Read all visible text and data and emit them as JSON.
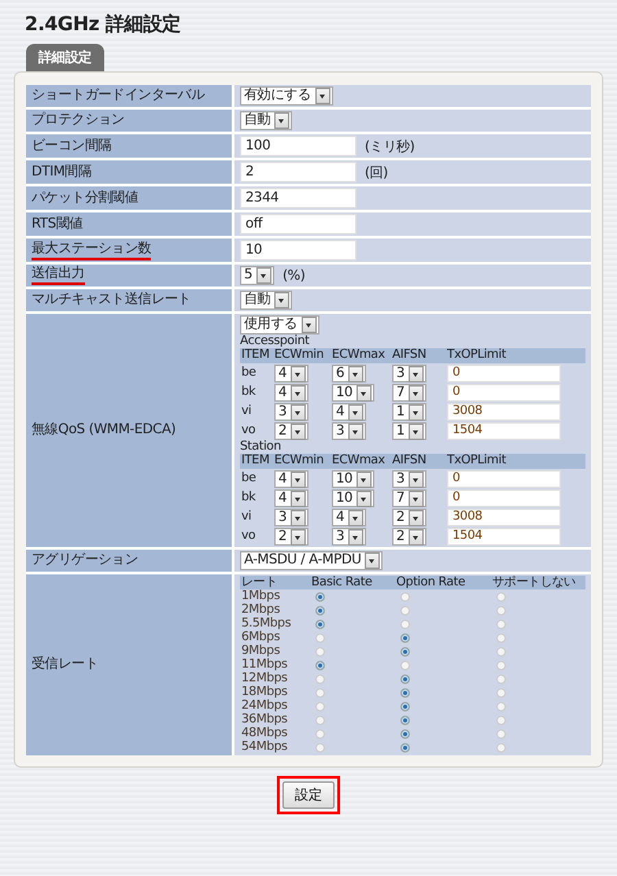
{
  "page_title": "2.4GHz 詳細設定",
  "tab": {
    "label": "詳細設定",
    "selected": true
  },
  "settings": [
    {
      "kind": "select",
      "label": "ショートガードインターバル",
      "value": "有効にする",
      "underlined": false
    },
    {
      "kind": "select",
      "label": "プロテクション",
      "value": "自動",
      "underlined": false
    },
    {
      "kind": "input",
      "label": "ビーコン間隔",
      "value": "100",
      "unit": "(ミリ秒)",
      "underlined": false
    },
    {
      "kind": "input",
      "label": "DTIM間隔",
      "value": "2",
      "unit": "(回)",
      "underlined": false
    },
    {
      "kind": "input",
      "label": "パケット分割閾値",
      "value": "2344",
      "underlined": false
    },
    {
      "kind": "input",
      "label": "RTS閾値",
      "value": "off",
      "underlined": false
    },
    {
      "kind": "input",
      "label": "最大ステーション数",
      "value": "10",
      "underlined": true
    },
    {
      "kind": "select",
      "label": "送信出力",
      "value": "5",
      "unit": "(%)",
      "underlined": true
    },
    {
      "kind": "select",
      "label": "マルチキャスト送信レート",
      "value": "自動",
      "underlined": false
    },
    {
      "kind": "qos",
      "label": "無線QoS (WMM-EDCA)",
      "value": "使用する",
      "underlined": false,
      "groups": [
        {
          "title": "Accesspoint",
          "columns": [
            "ITEM",
            "ECWmin",
            "ECWmax",
            "AIFSN",
            "TxOPLimit"
          ],
          "rows": [
            {
              "item": "be",
              "ecwmin": "4",
              "ecwmax": "6",
              "aifsn": "3",
              "txop": "0"
            },
            {
              "item": "bk",
              "ecwmin": "4",
              "ecwmax": "10",
              "aifsn": "7",
              "txop": "0"
            },
            {
              "item": "vi",
              "ecwmin": "3",
              "ecwmax": "4",
              "aifsn": "1",
              "txop": "3008"
            },
            {
              "item": "vo",
              "ecwmin": "2",
              "ecwmax": "3",
              "aifsn": "1",
              "txop": "1504"
            }
          ]
        },
        {
          "title": "Station",
          "columns": [
            "ITEM",
            "ECWmin",
            "ECWmax",
            "AIFSN",
            "TxOPLimit"
          ],
          "rows": [
            {
              "item": "be",
              "ecwmin": "4",
              "ecwmax": "10",
              "aifsn": "3",
              "txop": "0"
            },
            {
              "item": "bk",
              "ecwmin": "4",
              "ecwmax": "10",
              "aifsn": "7",
              "txop": "0"
            },
            {
              "item": "vi",
              "ecwmin": "3",
              "ecwmax": "4",
              "aifsn": "2",
              "txop": "3008"
            },
            {
              "item": "vo",
              "ecwmin": "2",
              "ecwmax": "3",
              "aifsn": "2",
              "txop": "1504"
            }
          ]
        }
      ]
    },
    {
      "kind": "select",
      "label": "アグリゲーション",
      "value": "A-MSDU / A-MPDU",
      "underlined": false
    },
    {
      "kind": "rates",
      "label": "受信レート",
      "underlined": false,
      "columns": [
        "レート",
        "Basic Rate",
        "Option Rate",
        "サポートしない"
      ],
      "rows": [
        {
          "rate": "1Mbps",
          "choices": [
            {
              "selected": true
            },
            {
              "selected": false
            },
            {
              "selected": false
            }
          ]
        },
        {
          "rate": "2Mbps",
          "choices": [
            {
              "selected": true
            },
            {
              "selected": false
            },
            {
              "selected": false
            }
          ]
        },
        {
          "rate": "5.5Mbps",
          "choices": [
            {
              "selected": true
            },
            {
              "selected": false
            },
            {
              "selected": false
            }
          ]
        },
        {
          "rate": "6Mbps",
          "choices": [
            {
              "selected": false
            },
            {
              "selected": true
            },
            {
              "selected": false
            }
          ]
        },
        {
          "rate": "9Mbps",
          "choices": [
            {
              "selected": false
            },
            {
              "selected": true
            },
            {
              "selected": false
            }
          ]
        },
        {
          "rate": "11Mbps",
          "choices": [
            {
              "selected": true
            },
            {
              "selected": false
            },
            {
              "selected": false
            }
          ]
        },
        {
          "rate": "12Mbps",
          "choices": [
            {
              "selected": false
            },
            {
              "selected": true
            },
            {
              "selected": false
            }
          ]
        },
        {
          "rate": "18Mbps",
          "choices": [
            {
              "selected": false
            },
            {
              "selected": true
            },
            {
              "selected": false
            }
          ]
        },
        {
          "rate": "24Mbps",
          "choices": [
            {
              "selected": false
            },
            {
              "selected": true
            },
            {
              "selected": false
            }
          ]
        },
        {
          "rate": "36Mbps",
          "choices": [
            {
              "selected": false
            },
            {
              "selected": true
            },
            {
              "selected": false
            }
          ]
        },
        {
          "rate": "48Mbps",
          "choices": [
            {
              "selected": false
            },
            {
              "selected": true
            },
            {
              "selected": false
            }
          ]
        },
        {
          "rate": "54Mbps",
          "choices": [
            {
              "selected": false
            },
            {
              "selected": true
            },
            {
              "selected": false
            }
          ]
        }
      ]
    }
  ],
  "submit": {
    "label": "設定",
    "highlighted": true
  }
}
